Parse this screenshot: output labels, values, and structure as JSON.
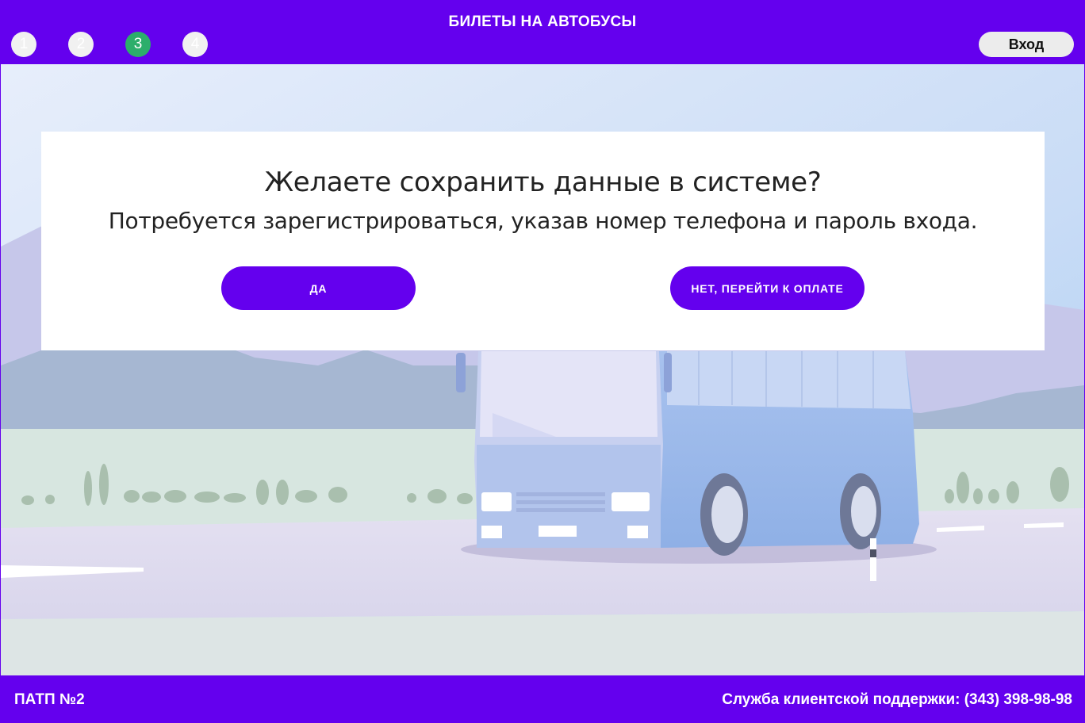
{
  "header": {
    "title": "БИЛЕТЫ НА АВТОБУСЫ",
    "steps": [
      "1",
      "2",
      "3",
      "4"
    ],
    "active_step": 3,
    "login_label": "Вход"
  },
  "dialog": {
    "title": "Желаете сохранить данные в системе?",
    "text": "Потребуется зарегистрироваться, указав номер телефона и пароль входа.",
    "yes_label": "ДА",
    "no_label": "НЕТ, ПЕРЕЙТИ К ОПЛАТЕ"
  },
  "footer": {
    "company": "ПАТП №2",
    "support": "Служба клиентской поддержки: (343) 398-98-98"
  },
  "colors": {
    "brand": "#6400ee",
    "active_step": "#2cae6b"
  }
}
